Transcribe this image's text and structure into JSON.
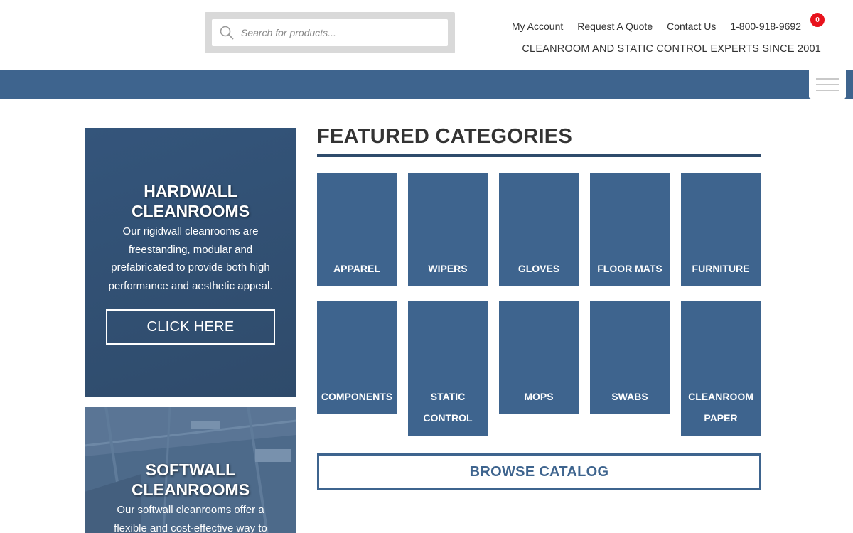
{
  "header": {
    "search_placeholder": "Search for products...",
    "links": [
      "My Account",
      "Request A Quote",
      "Contact Us",
      "1-800-918-9692"
    ],
    "cart_count": "0",
    "tagline": "CLEANROOM AND STATIC CONTROL EXPERTS SINCE 2001"
  },
  "promos": [
    {
      "title_line1": "HARDWALL",
      "title_line2": "CLEANROOMS",
      "text": "Our rigidwall cleanrooms are freestanding, modular and prefabricated to provide both high performance and aesthetic appeal.",
      "button": "CLICK HERE"
    },
    {
      "title_line1": "SOFTWALL",
      "title_line2": "CLEANROOMS",
      "text": "Our softwall cleanrooms offer a flexible and cost-effective way to"
    }
  ],
  "featured": {
    "title": "FEATURED CATEGORIES",
    "categories": [
      {
        "line1": "APPAREL",
        "line2": ""
      },
      {
        "line1": "WIPERS",
        "line2": ""
      },
      {
        "line1": "GLOVES",
        "line2": ""
      },
      {
        "line1": "FLOOR MATS",
        "line2": ""
      },
      {
        "line1": "FURNITURE",
        "line2": ""
      },
      {
        "line1": "COMPONENTS",
        "line2": ""
      },
      {
        "line1": "STATIC",
        "line2": "CONTROL"
      },
      {
        "line1": "MOPS",
        "line2": ""
      },
      {
        "line1": "SWABS",
        "line2": ""
      },
      {
        "line1": "CLEANROOM",
        "line2": "PAPER"
      }
    ],
    "browse_label": "BROWSE CATALOG"
  },
  "colors": {
    "brand_blue": "#3e648e",
    "dark_blue": "#2f4b6b",
    "cart_red": "#e8121c"
  }
}
